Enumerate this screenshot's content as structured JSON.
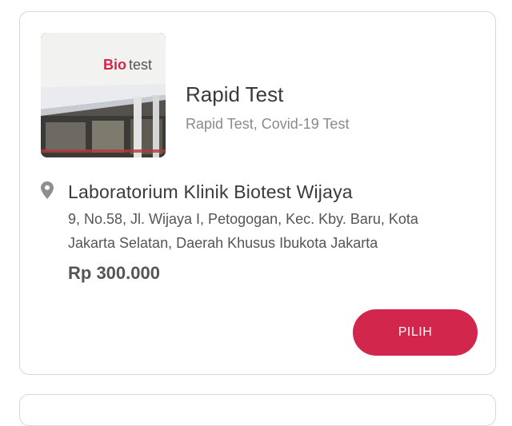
{
  "card": {
    "image_sign_text": "Biotest",
    "title": "Rapid Test",
    "subtitle": "Rapid Test, Covid-19 Test",
    "lab_name": "Laboratorium Klinik Biotest Wijaya",
    "address": "9, No.58, Jl. Wijaya I, Petogogan, Kec. Kby. Baru, Kota Jakarta Selatan, Daerah Khusus Ibukota Jakarta",
    "price": "Rp 300.000",
    "button_label": "PILIH"
  },
  "colors": {
    "accent": "#d3264d",
    "border": "#d8d8d8",
    "text_dark": "#3a3a3a",
    "text_muted": "#8a8a8a"
  },
  "icons": {
    "location": "location-pin-icon"
  }
}
